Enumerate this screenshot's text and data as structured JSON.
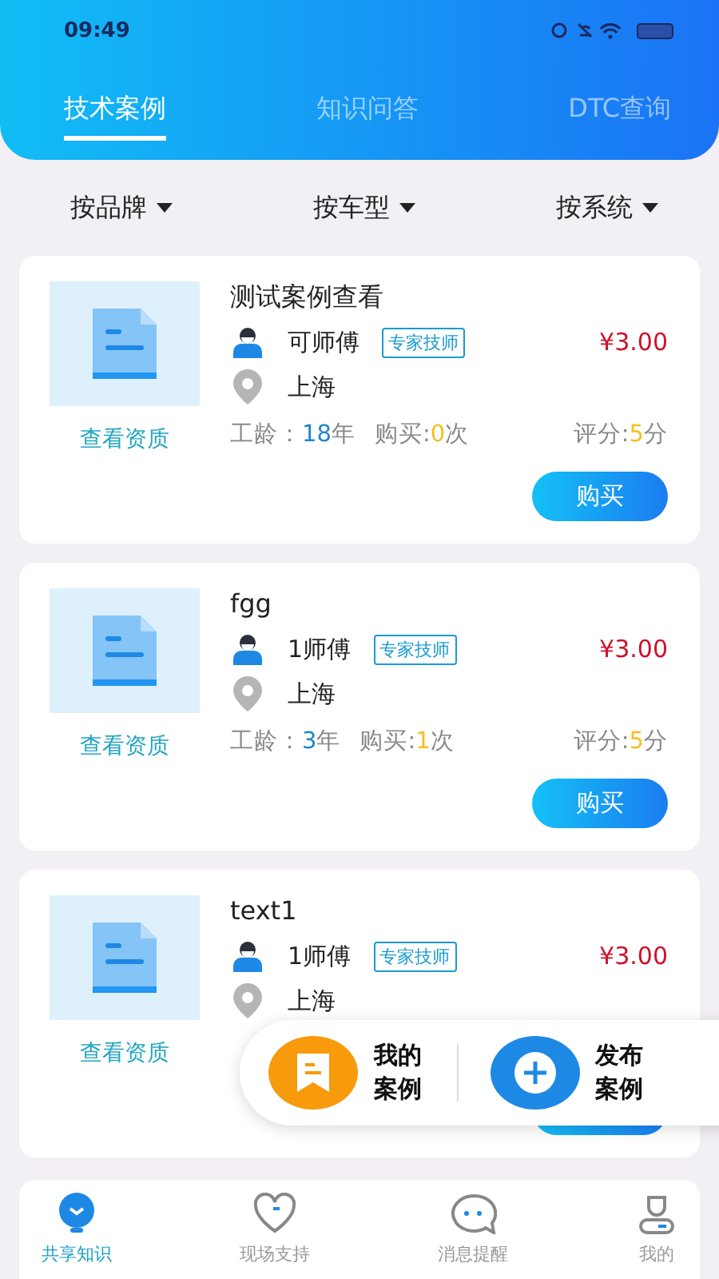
{
  "status_bar": {
    "time": "09:49"
  },
  "tabs": [
    {
      "label": "技术案例",
      "selected": true
    },
    {
      "label": "知识问答",
      "selected": false
    },
    {
      "label": "DTC查询",
      "selected": false
    }
  ],
  "filters": [
    "按品牌",
    "按车型",
    "按系统"
  ],
  "cases": [
    {
      "title": "测试案例查看",
      "name": "可师傅",
      "badge": "专家技师",
      "price": "¥3.00",
      "city": "上海",
      "link": "查看资质",
      "stats": {
        "years_label": "工龄：",
        "years": "18",
        "years_unit": "年",
        "buys_label": "购买:",
        "buys": "0",
        "buys_unit": "次",
        "score_label": "评分:",
        "score": "5",
        "score_unit": "分"
      },
      "buy_button": "购买"
    },
    {
      "title": "fgg",
      "name": "1师傅",
      "badge": "专家技师",
      "price": "¥3.00",
      "city": "上海",
      "link": "查看资质",
      "stats": {
        "years_label": "工龄：",
        "years": "3",
        "years_unit": "年",
        "buys_label": "购买:",
        "buys": "1",
        "buys_unit": "次",
        "score_label": "评分:",
        "score": "5",
        "score_unit": "分"
      },
      "buy_button": "购买"
    },
    {
      "title": "text1",
      "name": "1师傅",
      "badge": "专家技师",
      "price": "¥3.00",
      "city": "上海",
      "link": "查看资质"
    }
  ],
  "floating_actions": [
    {
      "label": "我的案例"
    },
    {
      "label": "发布案例"
    }
  ],
  "bottom_nav": [
    {
      "label": "共享知识",
      "selected": true
    },
    {
      "label": "现场支持",
      "selected": false
    },
    {
      "label": "消息提醒",
      "selected": false
    },
    {
      "label": "我的",
      "selected": false
    }
  ]
}
